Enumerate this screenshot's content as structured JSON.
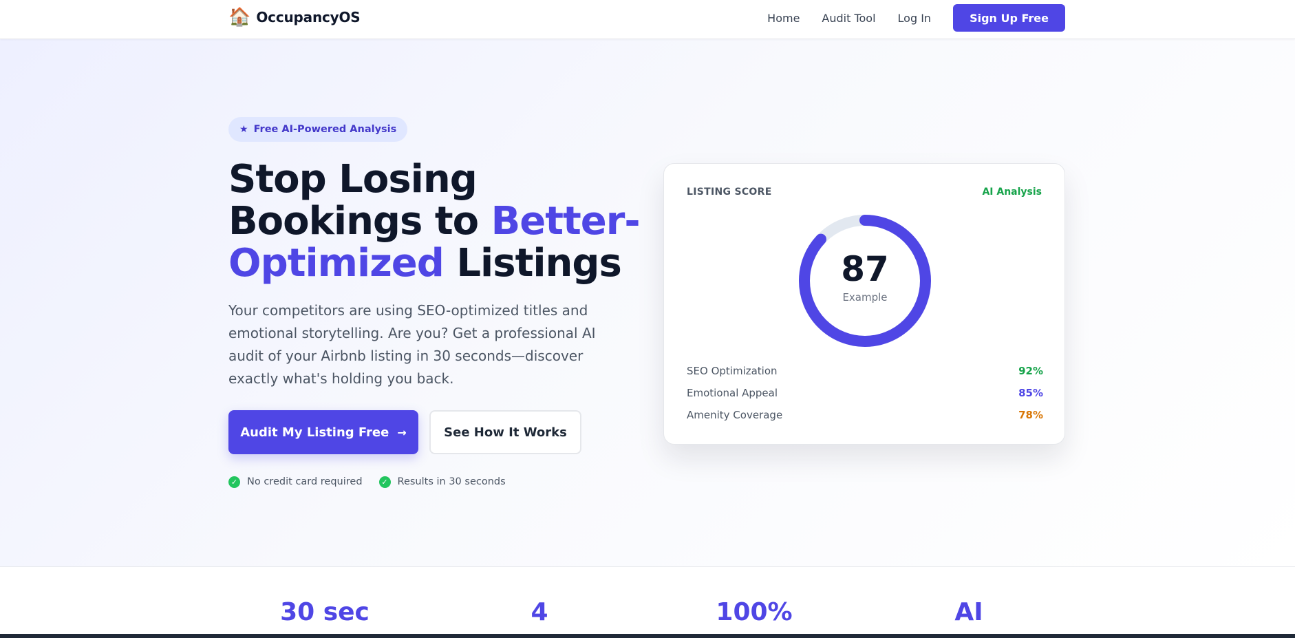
{
  "nav": {
    "brand_icon": "🏠",
    "brand_name": "OccupancyOS",
    "links": [
      "Home",
      "Audit Tool",
      "Log In"
    ],
    "cta": "Sign Up Free"
  },
  "hero": {
    "badge_icon": "★",
    "badge": "Free AI-Powered Analysis",
    "headline_part1": "Stop Losing Bookings to ",
    "headline_accent": "Better-Optimized",
    "headline_part2": " Listings",
    "subcopy": "Your competitors are using SEO-optimized titles and emotional storytelling. Are you? Get a professional AI audit of your Airbnb listing in 30 seconds—discover exactly what's holding you back.",
    "primary_cta": "Audit My Listing Free",
    "primary_cta_arrow": "→",
    "secondary_cta": "See How It Works",
    "checks": [
      "No credit card required",
      "Results in 30 seconds"
    ]
  },
  "card": {
    "label": "LISTING SCORE",
    "tag": "AI Analysis",
    "score": "87",
    "score_value": 87,
    "score_max": 100,
    "caption": "Example",
    "metrics": [
      {
        "label": "SEO Optimization",
        "value": "92%",
        "color": "#16a34a"
      },
      {
        "label": "Emotional Appeal",
        "value": "85%",
        "color": "#4f46e5"
      },
      {
        "label": "Amenity Coverage",
        "value": "78%",
        "color": "#d97706"
      }
    ]
  },
  "stats": [
    "30 sec",
    "4",
    "100%",
    "AI"
  ],
  "colors": {
    "accent": "#4f46e5",
    "success": "#16a34a",
    "warning": "#d97706",
    "track": "#e2e8f0"
  }
}
